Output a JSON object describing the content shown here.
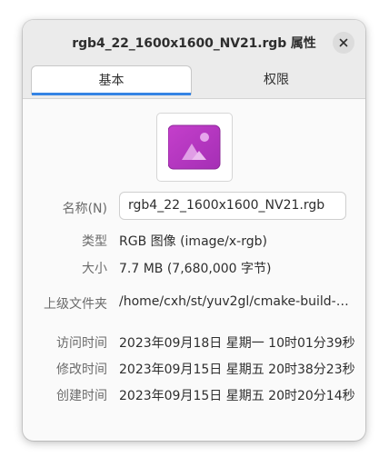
{
  "window": {
    "title": "rgb4_22_1600x1600_NV21.rgb 属性"
  },
  "tabs": [
    {
      "label": "基本",
      "active": true
    },
    {
      "label": "权限",
      "active": false
    }
  ],
  "thumbnail": {
    "icon": "image-file-icon",
    "colors": [
      "#c03cc4",
      "#d977e0",
      "#9a2fa9"
    ]
  },
  "properties": {
    "name": {
      "label": "名称(N)",
      "value": "rgb4_22_1600x1600_NV21.rgb"
    },
    "type": {
      "label": "类型",
      "value": "RGB 图像 (image/x-rgb)"
    },
    "size": {
      "label": "大小",
      "value": "7.7 MB (7,680,000 字节)"
    },
    "parent": {
      "label": "上级文件夹",
      "value": "/home/cxh/st/yuv2gl/cmake-build-…"
    },
    "accessed": {
      "label": "访问时间",
      "value": "2023年09月18日 星期一 10时01分39秒"
    },
    "modified": {
      "label": "修改时间",
      "value": "2023年09月15日 星期五 20时38分23秒"
    },
    "created": {
      "label": "创建时间",
      "value": "2023年09月15日 星期五 20时20分14秒"
    }
  },
  "colors": {
    "accent": "#3584e4",
    "headerbar": "#ebebeb",
    "background": "#fafafa"
  }
}
